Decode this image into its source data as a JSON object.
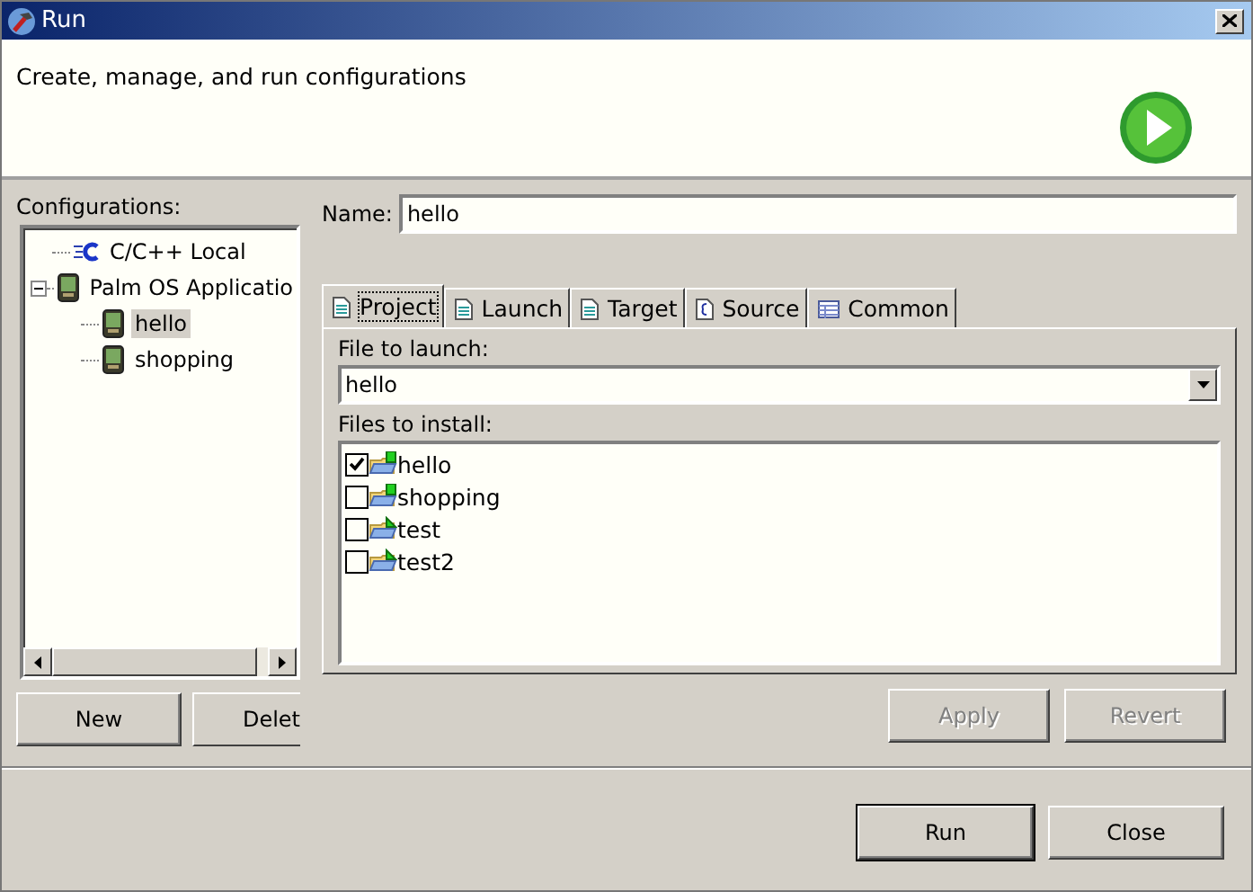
{
  "window": {
    "title": "Run"
  },
  "header": {
    "message": "Create, manage, and run configurations"
  },
  "configurations": {
    "label": "Configurations:",
    "tree": [
      {
        "label": "C/C++ Local",
        "kind": "cpp",
        "selected": false
      },
      {
        "label": "Palm OS Applicatio",
        "kind": "palm",
        "expanded": true,
        "selected": false,
        "children": [
          {
            "label": "hello",
            "kind": "palm",
            "selected": true
          },
          {
            "label": "shopping",
            "kind": "palm",
            "selected": false
          }
        ]
      }
    ],
    "buttons": [
      {
        "label": "New"
      },
      {
        "label": "Delet"
      }
    ]
  },
  "name_field": {
    "label": "Name:",
    "value": "hello"
  },
  "tabs": [
    {
      "label": "Project",
      "kind": "page",
      "selected": true
    },
    {
      "label": "Launch",
      "kind": "page",
      "selected": false
    },
    {
      "label": "Target",
      "kind": "page",
      "selected": false
    },
    {
      "label": "Source",
      "kind": "source",
      "selected": false
    },
    {
      "label": "Common",
      "kind": "table",
      "selected": false
    }
  ],
  "project": {
    "file_label": "File to launch:",
    "file_value": "hello",
    "install_label": "Files to install:",
    "files": [
      {
        "label": "hello",
        "kind": "app",
        "checked": true
      },
      {
        "label": "shopping",
        "kind": "app",
        "checked": false
      },
      {
        "label": "test",
        "kind": "lib",
        "checked": false
      },
      {
        "label": "test2",
        "kind": "lib",
        "checked": false
      }
    ]
  },
  "actions": [
    {
      "label": "Apply",
      "disabled": true
    },
    {
      "label": "Revert",
      "disabled": true
    }
  ],
  "footer_buttons": [
    {
      "label": "Run",
      "default": true
    },
    {
      "label": "Close",
      "default": false
    }
  ]
}
